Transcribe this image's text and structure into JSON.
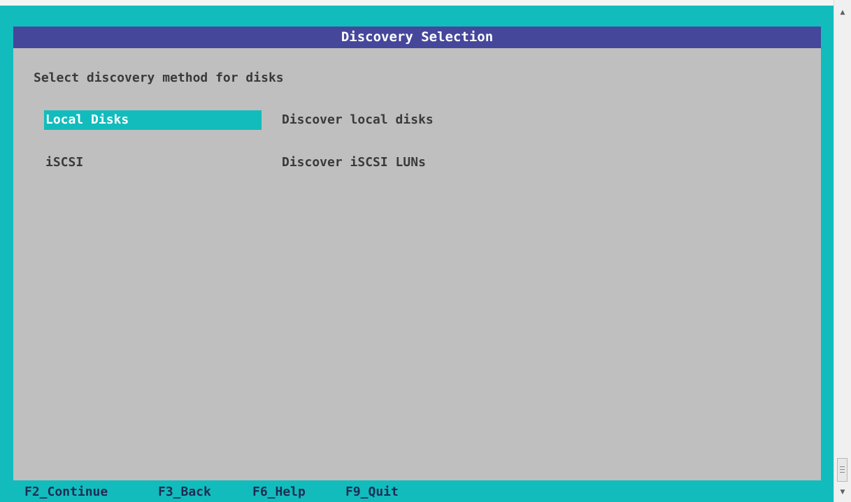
{
  "window": {
    "title": "Discovery Selection"
  },
  "prompt": "Select discovery method for disks",
  "methods": [
    {
      "name": "Local Disks",
      "description": "Discover local disks",
      "selected": true
    },
    {
      "name": "iSCSI",
      "description": "Discover iSCSI LUNs",
      "selected": false
    }
  ],
  "footer": {
    "keys": [
      "F2_Continue",
      "F3_Back",
      "F6_Help",
      "F9_Quit"
    ]
  },
  "colors": {
    "terminal_bg": "#12bcbc",
    "title_bar": "#45479b",
    "panel_bg": "#bfbfbf",
    "highlight": "#12bcbc"
  },
  "icons": {
    "scroll_up": "scroll-up-arrow-icon",
    "scroll_down": "scroll-down-arrow-icon"
  }
}
